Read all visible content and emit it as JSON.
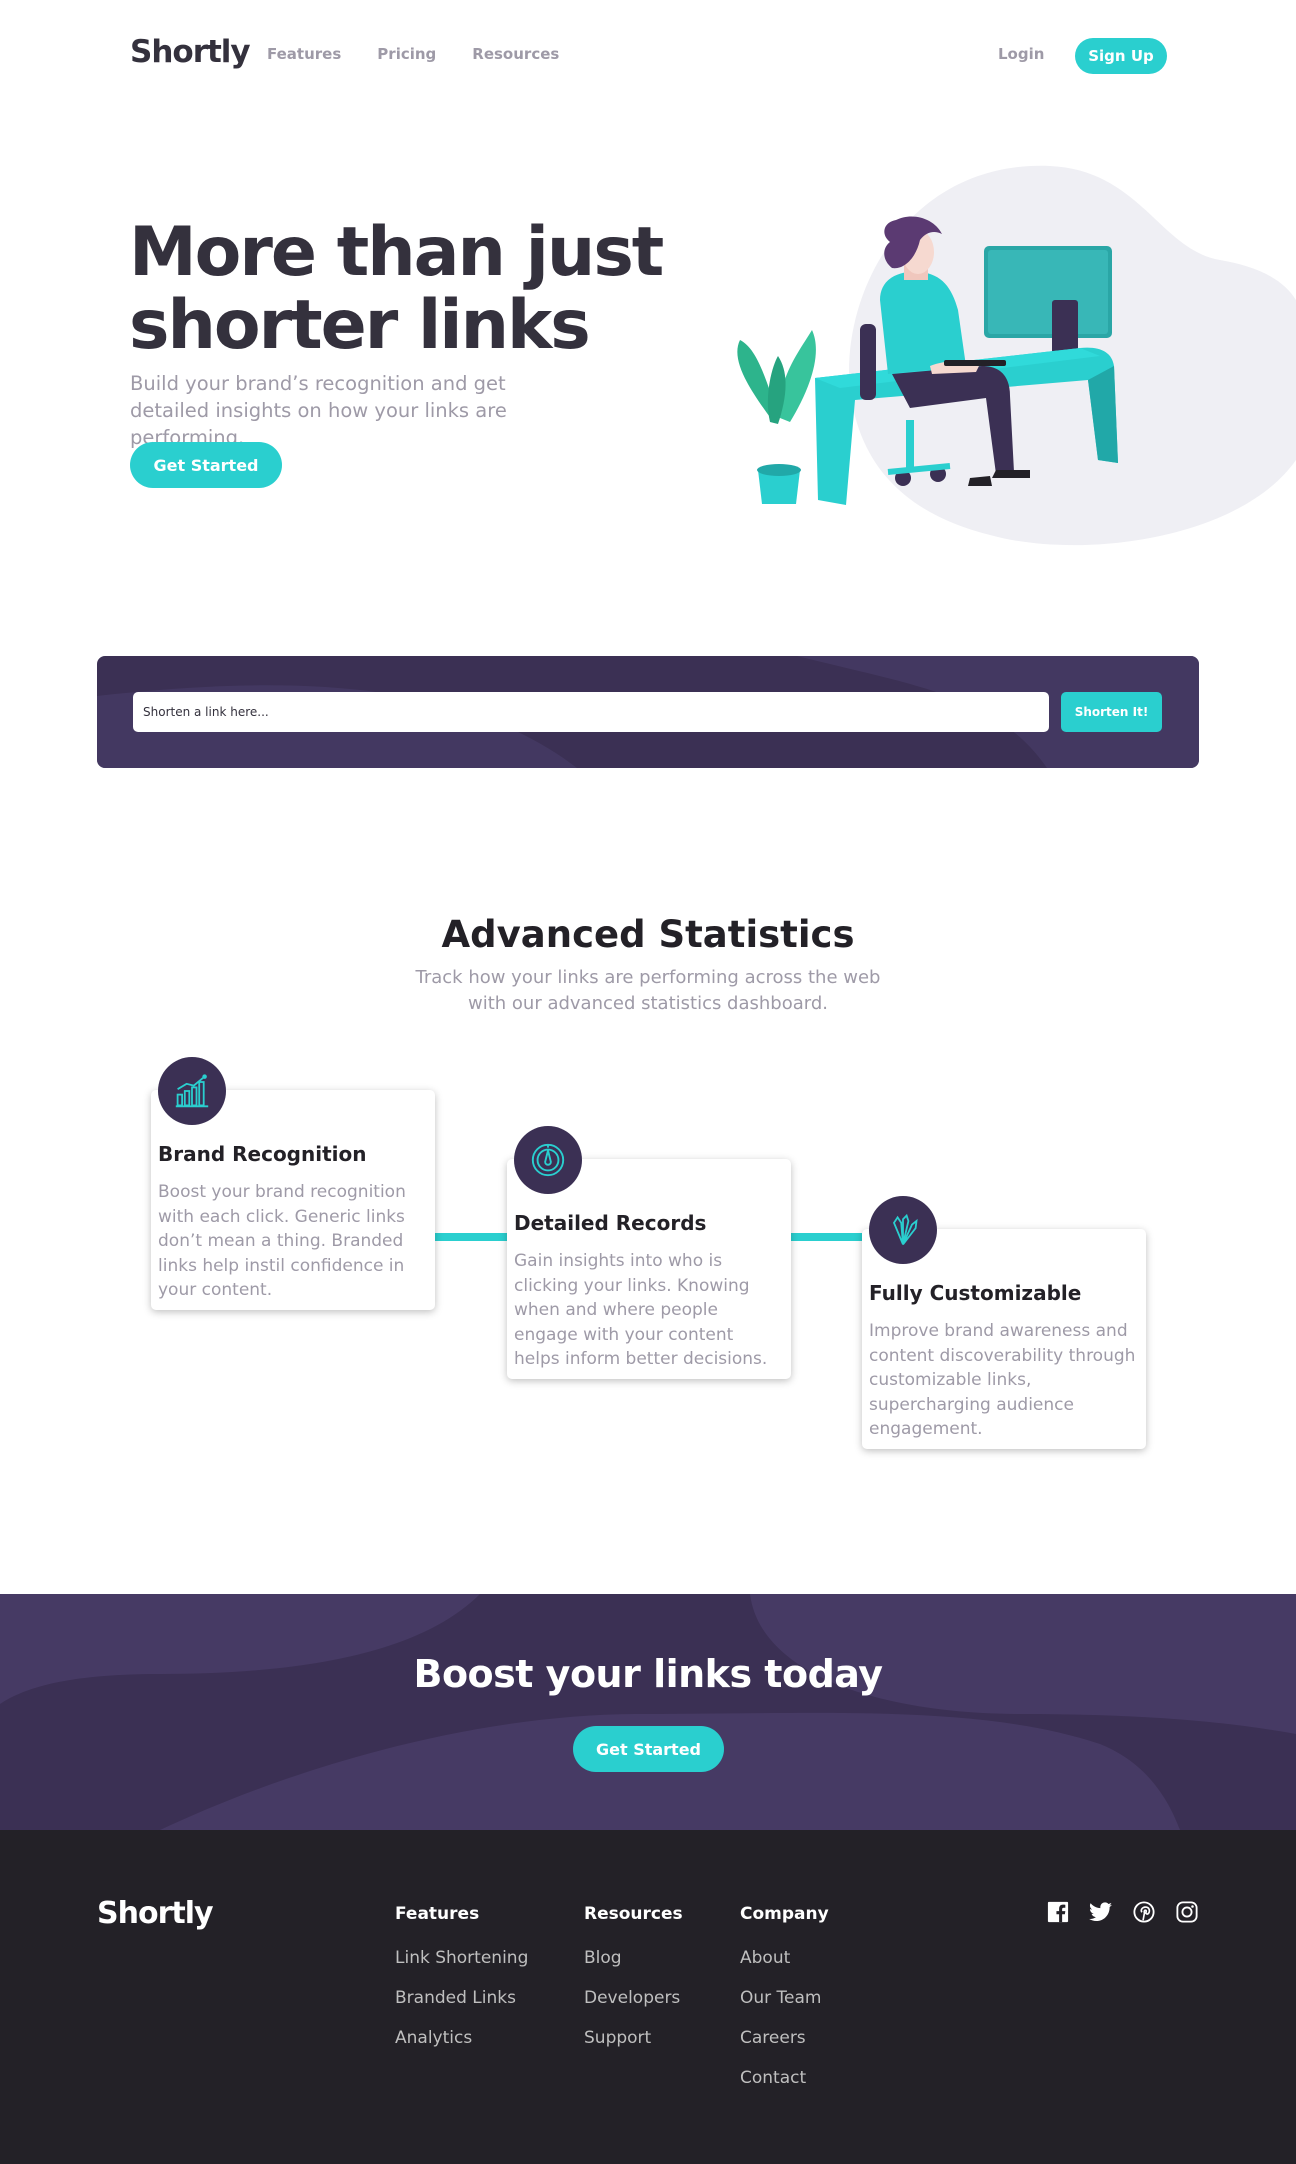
{
  "header": {
    "logo": "Shortly",
    "nav": [
      "Features",
      "Pricing",
      "Resources"
    ],
    "login": "Login",
    "signup": "Sign Up"
  },
  "hero": {
    "title": "More than just shorter links",
    "subtitle": "Build your brand’s recognition and get detailed insights on how your links are performing.",
    "cta": "Get Started"
  },
  "shorten": {
    "placeholder": "Shorten a link here...",
    "button": "Shorten It!"
  },
  "stats": {
    "title": "Advanced Statistics",
    "subtitle": "Track how your links are performing across the web with our advanced statistics dashboard.",
    "cards": [
      {
        "icon": "brand-recognition-icon",
        "title": "Brand Recognition",
        "text": "Boost your brand recognition with each click. Generic links don’t mean a thing. Branded links help instil confidence in your content."
      },
      {
        "icon": "detailed-records-icon",
        "title": "Detailed Records",
        "text": "Gain insights into who is clicking your links. Knowing when and where people engage with your content helps inform better decisions."
      },
      {
        "icon": "fully-customizable-icon",
        "title": "Fully Customizable",
        "text": "Improve brand awareness and content discoverability through customizable links, supercharging audience engagement."
      }
    ]
  },
  "boost": {
    "title": "Boost your links today",
    "cta": "Get Started"
  },
  "footer": {
    "logo": "Shortly",
    "columns": [
      {
        "heading": "Features",
        "links": [
          "Link Shortening",
          "Branded Links",
          "Analytics"
        ]
      },
      {
        "heading": "Resources",
        "links": [
          "Blog",
          "Developers",
          "Support"
        ]
      },
      {
        "heading": "Company",
        "links": [
          "About",
          "Our Team",
          "Careers",
          "Contact"
        ]
      }
    ],
    "socials": [
      "facebook-icon",
      "twitter-icon",
      "pinterest-icon",
      "instagram-icon"
    ]
  },
  "colors": {
    "cyan": "#2acfcf",
    "dark_violet": "#3b3054",
    "gray": "#9e9aa7",
    "very_dark_blue": "#34313d",
    "footer_bg": "#232127"
  }
}
